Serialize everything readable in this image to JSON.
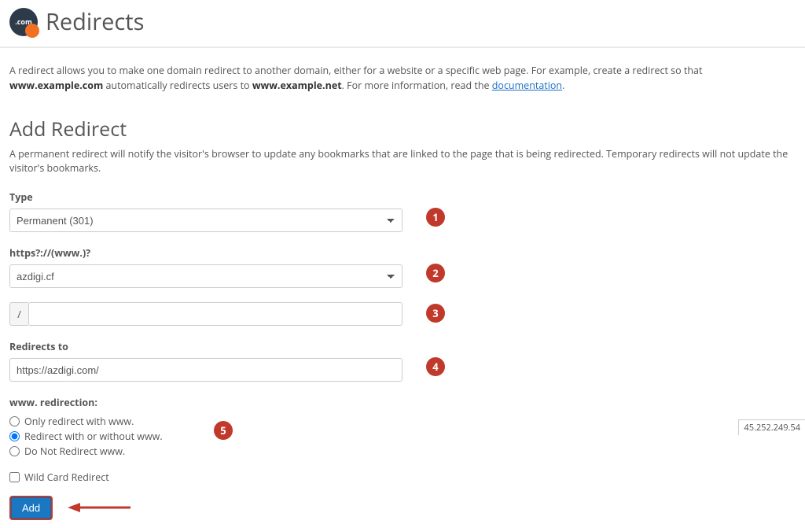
{
  "header": {
    "icon_label": ".com",
    "title": "Redirects"
  },
  "intro": {
    "pre": "A redirect allows you to make one domain redirect to another domain, either for a website or a specific web page. For example, create a redirect so that ",
    "example_from": "www.example.com",
    "mid": " automatically redirects users to ",
    "example_to": "www.example.net",
    "post": ". For more information, read the ",
    "doc_label": "documentation",
    "tail": "."
  },
  "form": {
    "title": "Add Redirect",
    "desc": "A permanent redirect will notify the visitor's browser to update any bookmarks that are linked to the page that is being redirected. Temporary redirects will not update the visitor's bookmarks.",
    "type_label": "Type",
    "type_value": "Permanent (301)",
    "domain_label": "https?://(www.)?",
    "domain_value": "azdigi.cf",
    "path_addon": "/",
    "path_value": "",
    "redirects_to_label": "Redirects to",
    "redirects_to_value": "https://azdigi.com/",
    "www_label": "www. redirection:",
    "www_options": {
      "only": "Only redirect with www.",
      "both": "Redirect with or without www.",
      "none": "Do Not Redirect www."
    },
    "wildcard_label": "Wild Card Redirect",
    "submit_label": "Add"
  },
  "annotations": {
    "b1": "1",
    "b2": "2",
    "b3": "3",
    "b4": "4",
    "b5": "5"
  },
  "footer": {
    "ip_fragment": "45.252.249.54"
  }
}
